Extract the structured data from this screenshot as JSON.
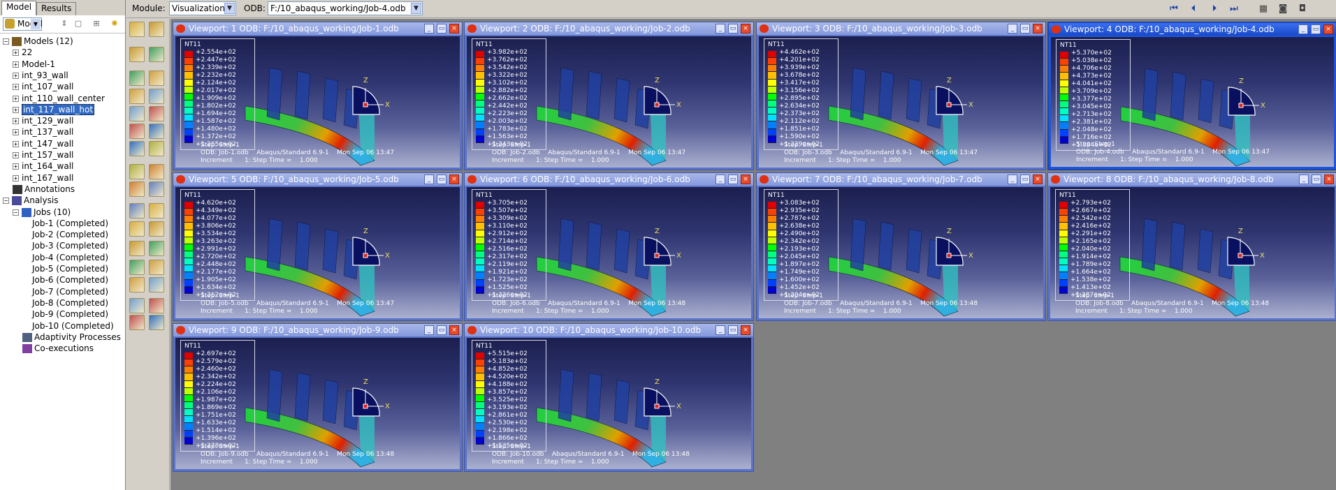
{
  "left_tabs": [
    "Model",
    "Results"
  ],
  "tree_toolbar": {
    "selector": "Model"
  },
  "tree": {
    "root": "Models (12)",
    "models": [
      "22",
      "Model-1",
      "int_93_wall",
      "int_107_wall",
      "int_110_wall_center",
      "int_117_wall_hot",
      "int_129_wall",
      "int_137_wall",
      "int_147_wall",
      "int_157_wall",
      "int_164_wall",
      "int_167_wall"
    ],
    "annotations": "Annotations",
    "analysis": "Analysis",
    "jobs_label": "Jobs (10)",
    "jobs": [
      "Job-1 (Completed)",
      "Job-2 (Completed)",
      "Job-3 (Completed)",
      "Job-4 (Completed)",
      "Job-5 (Completed)",
      "Job-6 (Completed)",
      "Job-7 (Completed)",
      "Job-8 (Completed)",
      "Job-9 (Completed)",
      "Job-10 (Completed)"
    ],
    "adaptivity": "Adaptivity Processes",
    "coexec": "Co-executions"
  },
  "toolbar": {
    "module_label": "Module:",
    "module_value": "Visualization",
    "odb_label": "ODB:",
    "odb_value": "F:/10_abaqus_working/Job-4.odb"
  },
  "viewports": [
    {
      "title": "Viewport: 1",
      "odb": "ODB: F:/10_abaqus_working/Job-1.odb",
      "legend": [
        "+2.554e+02",
        "+2.447e+02",
        "+2.339e+02",
        "+2.232e+02",
        "+2.124e+02",
        "+2.017e+02",
        "+1.909e+02",
        "+1.802e+02",
        "+1.694e+02",
        "+1.587e+02",
        "+1.480e+02",
        "+1.372e+02",
        "+1.265e+02"
      ],
      "foot": "ODB: Job-1.odb    Abaqus/Standard 6.9-1    Mon Sep 06 13:47"
    },
    {
      "title": "Viewport: 2",
      "odb": "ODB: F:/10_abaqus_working/Job-2.odb",
      "legend": [
        "+3.982e+02",
        "+3.762e+02",
        "+3.542e+02",
        "+3.322e+02",
        "+3.102e+02",
        "+2.882e+02",
        "+2.662e+02",
        "+2.442e+02",
        "+2.223e+02",
        "+2.003e+02",
        "+1.783e+02",
        "+1.563e+02",
        "+1.343e+02"
      ],
      "foot": "ODB: Job-2.odb    Abaqus/Standard 6.9-1    Mon Sep 06 13:47"
    },
    {
      "title": "Viewport: 3",
      "odb": "ODB: F:/10_abaqus_working/Job-3.odb",
      "legend": [
        "+4.462e+02",
        "+4.201e+02",
        "+3.939e+02",
        "+3.678e+02",
        "+3.417e+02",
        "+3.156e+02",
        "+2.895e+02",
        "+2.634e+02",
        "+2.373e+02",
        "+2.112e+02",
        "+1.851e+02",
        "+1.590e+02",
        "+1.329e+02"
      ],
      "foot": "ODB: Job-3.odb    Abaqus/Standard 6.9-1    Mon Sep 06 13:47"
    },
    {
      "title": "Viewport: 4",
      "odb": "ODB: F:/10_abaqus_working/Job-4.odb",
      "legend": [
        "+5.370e+02",
        "+5.038e+02",
        "+4.706e+02",
        "+4.373e+02",
        "+4.041e+02",
        "+3.709e+02",
        "+3.377e+02",
        "+3.045e+02",
        "+2.713e+02",
        "+2.381e+02",
        "+2.048e+02",
        "+1.716e+02",
        "+1.384e+02"
      ],
      "foot": "ODB: Job-4.odb    Abaqus/Standard 6.9-1    Mon Sep 06 13:47"
    },
    {
      "title": "Viewport: 5",
      "odb": "ODB: F:/10_abaqus_working/Job-5.odb",
      "legend": [
        "+4.620e+02",
        "+4.349e+02",
        "+4.077e+02",
        "+3.806e+02",
        "+3.534e+02",
        "+3.263e+02",
        "+2.991e+02",
        "+2.720e+02",
        "+2.448e+02",
        "+2.177e+02",
        "+1.905e+02",
        "+1.634e+02",
        "+1.362e+02"
      ],
      "foot": "ODB: Job-5.odb    Abaqus/Standard 6.9-1    Mon Sep 06 13:47"
    },
    {
      "title": "Viewport: 6",
      "odb": "ODB: F:/10_abaqus_working/Job-6.odb",
      "legend": [
        "+3.705e+02",
        "+3.507e+02",
        "+3.309e+02",
        "+3.110e+02",
        "+2.912e+02",
        "+2.714e+02",
        "+2.516e+02",
        "+2.317e+02",
        "+2.119e+02",
        "+1.921e+02",
        "+1.723e+02",
        "+1.525e+02",
        "+1.326e+02"
      ],
      "foot": "ODB: Job-6.odb    Abaqus/Standard 6.9-1    Mon Sep 06 13:48"
    },
    {
      "title": "Viewport: 7",
      "odb": "ODB: F:/10_abaqus_working/Job-7.odb",
      "legend": [
        "+3.083e+02",
        "+2.935e+02",
        "+2.787e+02",
        "+2.638e+02",
        "+2.490e+02",
        "+2.342e+02",
        "+2.193e+02",
        "+2.045e+02",
        "+1.897e+02",
        "+1.749e+02",
        "+1.600e+02",
        "+1.452e+02",
        "+1.304e+02"
      ],
      "foot": "ODB: Job-7.odb    Abaqus/Standard 6.9-1    Mon Sep 06 13:48"
    },
    {
      "title": "Viewport: 8",
      "odb": "ODB: F:/10_abaqus_working/Job-8.odb",
      "legend": [
        "+2.793e+02",
        "+2.667e+02",
        "+2.542e+02",
        "+2.416e+02",
        "+2.291e+02",
        "+2.165e+02",
        "+2.040e+02",
        "+1.914e+02",
        "+1.789e+02",
        "+1.664e+02",
        "+1.538e+02",
        "+1.413e+02",
        "+1.287e+02"
      ],
      "foot": "ODB: Job-8.odb    Abaqus/Standard 6.9-1    Mon Sep 06 13:48"
    },
    {
      "title": "Viewport: 9",
      "odb": "ODB: F:/10_abaqus_working/Job-9.odb",
      "legend": [
        "+2.697e+02",
        "+2.579e+02",
        "+2.460e+02",
        "+2.342e+02",
        "+2.224e+02",
        "+2.106e+02",
        "+1.987e+02",
        "+1.869e+02",
        "+1.751e+02",
        "+1.633e+02",
        "+1.514e+02",
        "+1.396e+02",
        "+1.278e+02"
      ],
      "foot": "ODB: Job-9.odb    Abaqus/Standard 6.9-1    Mon Sep 06 13:48"
    },
    {
      "title": "Viewport: 10",
      "odb": "ODB: F:/10_abaqus_working/Job-10.odb",
      "legend": [
        "+5.515e+02",
        "+5.183e+02",
        "+4.852e+02",
        "+4.520e+02",
        "+4.188e+02",
        "+3.857e+02",
        "+3.525e+02",
        "+3.193e+02",
        "+2.861e+02",
        "+2.530e+02",
        "+2.198e+02",
        "+1.866e+02",
        "+1.535e+02"
      ],
      "foot": "ODB: Job-10.odb    Abaqus/Standard 6.9-1    Mon Sep 06 13:48"
    }
  ],
  "legend_header": "NT11",
  "foot_line2": "Increment      1: Step Time =    1.000",
  "foot_step": "Step: Step-1",
  "axis_z": "Z",
  "axis_x": "X"
}
